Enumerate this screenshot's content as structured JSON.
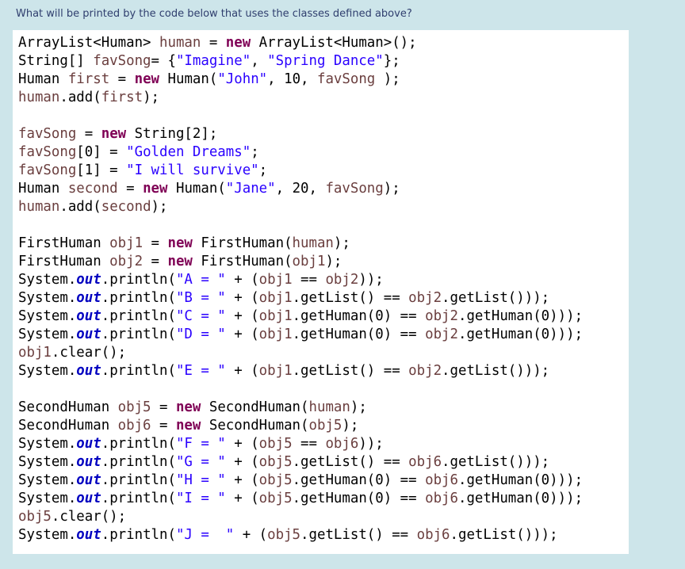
{
  "question": "What will be printed by the code below that uses the classes defined above?",
  "code_lines": [
    [
      {
        "t": "ArrayList<Human> "
      },
      {
        "t": "human",
        "c": "var"
      },
      {
        "t": " = "
      },
      {
        "t": "new",
        "c": "kw"
      },
      {
        "t": " ArrayList<Human>();"
      }
    ],
    [
      {
        "t": "String[] "
      },
      {
        "t": "favSong",
        "c": "var"
      },
      {
        "t": "= {"
      },
      {
        "t": "\"Imagine\"",
        "c": "str"
      },
      {
        "t": ", "
      },
      {
        "t": "\"Spring Dance\"",
        "c": "str"
      },
      {
        "t": "};"
      }
    ],
    [
      {
        "t": "Human "
      },
      {
        "t": "first",
        "c": "var"
      },
      {
        "t": " = "
      },
      {
        "t": "new",
        "c": "kw"
      },
      {
        "t": " Human("
      },
      {
        "t": "\"John\"",
        "c": "str"
      },
      {
        "t": ", 10, "
      },
      {
        "t": "favSong",
        "c": "var"
      },
      {
        "t": " );"
      }
    ],
    [
      {
        "t": "human",
        "c": "var"
      },
      {
        "t": ".add("
      },
      {
        "t": "first",
        "c": "var"
      },
      {
        "t": ");"
      }
    ],
    [],
    [
      {
        "t": "favSong",
        "c": "var"
      },
      {
        "t": " = "
      },
      {
        "t": "new",
        "c": "kw"
      },
      {
        "t": " String[2];"
      }
    ],
    [
      {
        "t": "favSong",
        "c": "var"
      },
      {
        "t": "[0] = "
      },
      {
        "t": "\"Golden Dreams\"",
        "c": "str"
      },
      {
        "t": ";"
      }
    ],
    [
      {
        "t": "favSong",
        "c": "var"
      },
      {
        "t": "[1] = "
      },
      {
        "t": "\"I will survive\"",
        "c": "str"
      },
      {
        "t": ";"
      }
    ],
    [
      {
        "t": "Human "
      },
      {
        "t": "second",
        "c": "var"
      },
      {
        "t": " = "
      },
      {
        "t": "new",
        "c": "kw"
      },
      {
        "t": " Human("
      },
      {
        "t": "\"Jane\"",
        "c": "str"
      },
      {
        "t": ", 20, "
      },
      {
        "t": "favSong",
        "c": "var"
      },
      {
        "t": ");"
      }
    ],
    [
      {
        "t": "human",
        "c": "var"
      },
      {
        "t": ".add("
      },
      {
        "t": "second",
        "c": "var"
      },
      {
        "t": ");"
      }
    ],
    [],
    [
      {
        "t": "FirstHuman "
      },
      {
        "t": "obj1",
        "c": "var"
      },
      {
        "t": " = "
      },
      {
        "t": "new",
        "c": "kw"
      },
      {
        "t": " FirstHuman("
      },
      {
        "t": "human",
        "c": "var"
      },
      {
        "t": ");"
      }
    ],
    [
      {
        "t": "FirstHuman "
      },
      {
        "t": "obj2",
        "c": "var"
      },
      {
        "t": " = "
      },
      {
        "t": "new",
        "c": "kw"
      },
      {
        "t": " FirstHuman("
      },
      {
        "t": "obj1",
        "c": "var"
      },
      {
        "t": ");"
      }
    ],
    [
      {
        "t": "System."
      },
      {
        "t": "out",
        "c": "fld"
      },
      {
        "t": ".println("
      },
      {
        "t": "\"A = \"",
        "c": "str"
      },
      {
        "t": " + ("
      },
      {
        "t": "obj1",
        "c": "var"
      },
      {
        "t": " == "
      },
      {
        "t": "obj2",
        "c": "var"
      },
      {
        "t": "));"
      }
    ],
    [
      {
        "t": "System."
      },
      {
        "t": "out",
        "c": "fld"
      },
      {
        "t": ".println("
      },
      {
        "t": "\"B = \"",
        "c": "str"
      },
      {
        "t": " + ("
      },
      {
        "t": "obj1",
        "c": "var"
      },
      {
        "t": ".getList() == "
      },
      {
        "t": "obj2",
        "c": "var"
      },
      {
        "t": ".getList()));"
      }
    ],
    [
      {
        "t": "System."
      },
      {
        "t": "out",
        "c": "fld"
      },
      {
        "t": ".println("
      },
      {
        "t": "\"C = \"",
        "c": "str"
      },
      {
        "t": " + ("
      },
      {
        "t": "obj1",
        "c": "var"
      },
      {
        "t": ".getHuman(0) == "
      },
      {
        "t": "obj2",
        "c": "var"
      },
      {
        "t": ".getHuman(0)));"
      }
    ],
    [
      {
        "t": "System."
      },
      {
        "t": "out",
        "c": "fld"
      },
      {
        "t": ".println("
      },
      {
        "t": "\"D = \"",
        "c": "str"
      },
      {
        "t": " + ("
      },
      {
        "t": "obj1",
        "c": "var"
      },
      {
        "t": ".getHuman(0) == "
      },
      {
        "t": "obj2",
        "c": "var"
      },
      {
        "t": ".getHuman(0)));"
      }
    ],
    [
      {
        "t": "obj1",
        "c": "var"
      },
      {
        "t": ".clear();"
      }
    ],
    [
      {
        "t": "System."
      },
      {
        "t": "out",
        "c": "fld"
      },
      {
        "t": ".println("
      },
      {
        "t": "\"E = \"",
        "c": "str"
      },
      {
        "t": " + ("
      },
      {
        "t": "obj1",
        "c": "var"
      },
      {
        "t": ".getList() == "
      },
      {
        "t": "obj2",
        "c": "var"
      },
      {
        "t": ".getList()));"
      }
    ],
    [],
    [
      {
        "t": "SecondHuman "
      },
      {
        "t": "obj5",
        "c": "var"
      },
      {
        "t": " = "
      },
      {
        "t": "new",
        "c": "kw"
      },
      {
        "t": " SecondHuman("
      },
      {
        "t": "human",
        "c": "var"
      },
      {
        "t": ");"
      }
    ],
    [
      {
        "t": "SecondHuman "
      },
      {
        "t": "obj6",
        "c": "var"
      },
      {
        "t": " = "
      },
      {
        "t": "new",
        "c": "kw"
      },
      {
        "t": " SecondHuman("
      },
      {
        "t": "obj5",
        "c": "var"
      },
      {
        "t": ");"
      }
    ],
    [
      {
        "t": "System."
      },
      {
        "t": "out",
        "c": "fld"
      },
      {
        "t": ".println("
      },
      {
        "t": "\"F = \"",
        "c": "str"
      },
      {
        "t": " + ("
      },
      {
        "t": "obj5",
        "c": "var"
      },
      {
        "t": " == "
      },
      {
        "t": "obj6",
        "c": "var"
      },
      {
        "t": "));"
      }
    ],
    [
      {
        "t": "System."
      },
      {
        "t": "out",
        "c": "fld"
      },
      {
        "t": ".println("
      },
      {
        "t": "\"G = \"",
        "c": "str"
      },
      {
        "t": " + ("
      },
      {
        "t": "obj5",
        "c": "var"
      },
      {
        "t": ".getList() == "
      },
      {
        "t": "obj6",
        "c": "var"
      },
      {
        "t": ".getList()));"
      }
    ],
    [
      {
        "t": "System."
      },
      {
        "t": "out",
        "c": "fld"
      },
      {
        "t": ".println("
      },
      {
        "t": "\"H = \"",
        "c": "str"
      },
      {
        "t": " + ("
      },
      {
        "t": "obj5",
        "c": "var"
      },
      {
        "t": ".getHuman(0) == "
      },
      {
        "t": "obj6",
        "c": "var"
      },
      {
        "t": ".getHuman(0)));"
      }
    ],
    [
      {
        "t": "System."
      },
      {
        "t": "out",
        "c": "fld"
      },
      {
        "t": ".println("
      },
      {
        "t": "\"I = \"",
        "c": "str"
      },
      {
        "t": " + ("
      },
      {
        "t": "obj5",
        "c": "var"
      },
      {
        "t": ".getHuman(0) == "
      },
      {
        "t": "obj6",
        "c": "var"
      },
      {
        "t": ".getHuman(0)));"
      }
    ],
    [
      {
        "t": "obj5",
        "c": "var"
      },
      {
        "t": ".clear();"
      }
    ],
    [
      {
        "t": "System."
      },
      {
        "t": "out",
        "c": "fld"
      },
      {
        "t": ".println("
      },
      {
        "t": "\"J =  \"",
        "c": "str"
      },
      {
        "t": " + ("
      },
      {
        "t": "obj5",
        "c": "var"
      },
      {
        "t": ".getList() == "
      },
      {
        "t": "obj6",
        "c": "var"
      },
      {
        "t": ".getList()));"
      }
    ]
  ],
  "colors": {
    "page_background": "#cde5ea",
    "question_text": "#2f3e6e",
    "code_background": "#ffffff",
    "keyword": "#7f0055",
    "string": "#2a00ff",
    "variable": "#6a3e3e",
    "static_field": "#0000c0"
  }
}
